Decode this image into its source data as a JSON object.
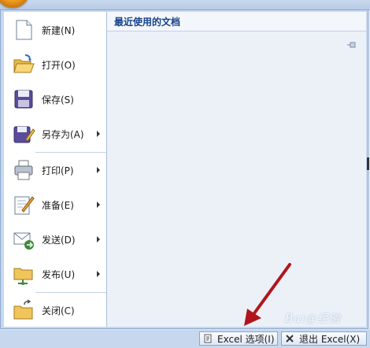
{
  "menu": {
    "items": [
      {
        "label": "新建(N)",
        "has_submenu": false,
        "icon": "new-document-icon"
      },
      {
        "label": "打开(O)",
        "has_submenu": false,
        "icon": "open-folder-icon"
      },
      {
        "label": "保存(S)",
        "has_submenu": false,
        "icon": "save-disk-icon"
      },
      {
        "label": "另存为(A)",
        "has_submenu": true,
        "icon": "save-as-icon"
      },
      {
        "label": "打印(P)",
        "has_submenu": true,
        "icon": "printer-icon"
      },
      {
        "label": "准备(E)",
        "has_submenu": true,
        "icon": "prepare-pencil-icon"
      },
      {
        "label": "发送(D)",
        "has_submenu": true,
        "icon": "send-envelope-icon"
      },
      {
        "label": "发布(U)",
        "has_submenu": true,
        "icon": "publish-folder-icon"
      },
      {
        "label": "关闭(C)",
        "has_submenu": false,
        "icon": "close-folder-icon"
      }
    ]
  },
  "recent": {
    "title": "最近使用的文档"
  },
  "footer": {
    "options_label": "Excel 选项(I)",
    "exit_label": "退出 Excel(X)"
  },
  "watermark": "Bai@经验"
}
